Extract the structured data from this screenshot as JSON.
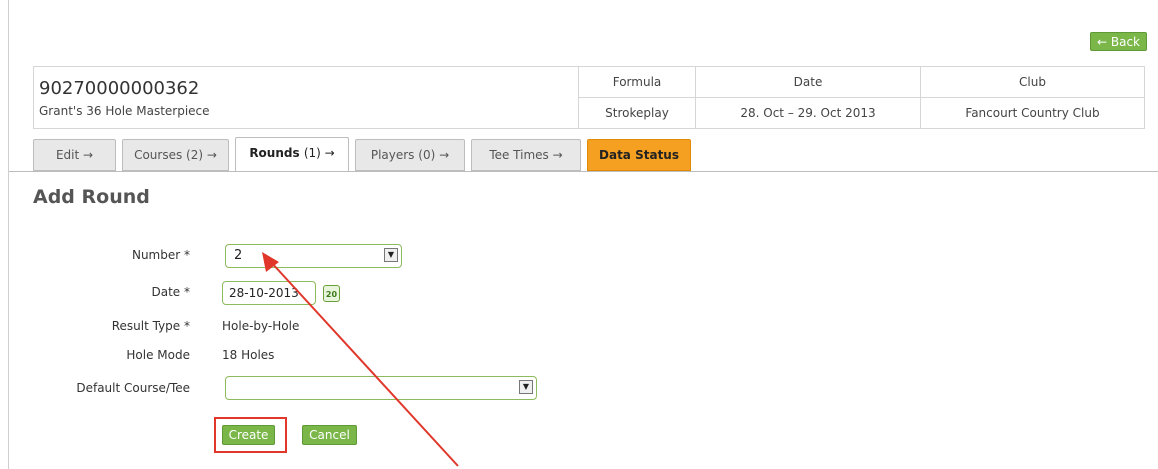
{
  "back_label": "← Back",
  "tournament": {
    "id": "90270000000362",
    "name": "Grant's 36 Hole Masterpiece",
    "columns": [
      {
        "header": "Formula",
        "value": "Strokeplay"
      },
      {
        "header": "Date",
        "value": "28. Oct – 29. Oct 2013"
      },
      {
        "header": "Club",
        "value": "Fancourt Country Club"
      }
    ]
  },
  "tabs": [
    {
      "label": "Edit →",
      "count": ""
    },
    {
      "label": "Courses",
      "count": "(2) →"
    },
    {
      "label": "Rounds",
      "count": "(1) →"
    },
    {
      "label": "Players",
      "count": "(0) →"
    },
    {
      "label": "Tee Times →",
      "count": ""
    },
    {
      "label": "Data Status",
      "count": ""
    }
  ],
  "form": {
    "title": "Add Round",
    "number_label": "Number *",
    "number_value": "2",
    "date_label": "Date *",
    "date_value": "28-10-2013",
    "calendar_icon_text": "20",
    "result_type_label": "Result Type *",
    "result_type_value": "Hole-by-Hole",
    "hole_mode_label": "Hole Mode",
    "hole_mode_value": "18 Holes",
    "default_course_label": "Default Course/Tee",
    "default_course_value": "",
    "create_label": "Create",
    "cancel_label": "Cancel"
  },
  "annotation_color": "#e0372a",
  "accent_green": "#7ab648",
  "accent_orange": "#f5a021"
}
